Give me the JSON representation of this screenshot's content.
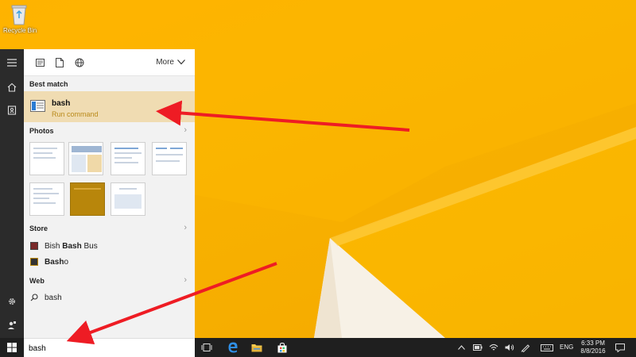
{
  "desktop": {
    "recycle_bin_label": "Recycle Bin"
  },
  "search_panel": {
    "filter_tabs": [
      {
        "icon": "apps-icon"
      },
      {
        "icon": "document-icon"
      },
      {
        "icon": "web-globe-icon"
      }
    ],
    "more_label": "More",
    "best_match": {
      "header": "Best match",
      "title": "bash",
      "subtitle": "Run command"
    },
    "photos_header": "Photos",
    "store": {
      "header": "Store",
      "items": [
        {
          "prefix": "Bish ",
          "bold": "Bash",
          "suffix": " Bus"
        },
        {
          "prefix": "",
          "bold": "Bash",
          "suffix": "o"
        }
      ]
    },
    "web": {
      "header": "Web",
      "query": "bash"
    }
  },
  "search_box": {
    "value": "bash"
  },
  "taskbar": {
    "apps": [
      {
        "icon": "task-view-icon"
      },
      {
        "icon": "edge-browser-icon"
      },
      {
        "icon": "file-explorer-icon"
      },
      {
        "icon": "store-icon"
      }
    ],
    "language": "ENG",
    "time": "6:33 PM",
    "date": "8/8/2016"
  },
  "colors": {
    "wallpaper": "#f9b300",
    "best_match_highlight": "#f0dcb2",
    "arrow": "#ee1c24"
  }
}
